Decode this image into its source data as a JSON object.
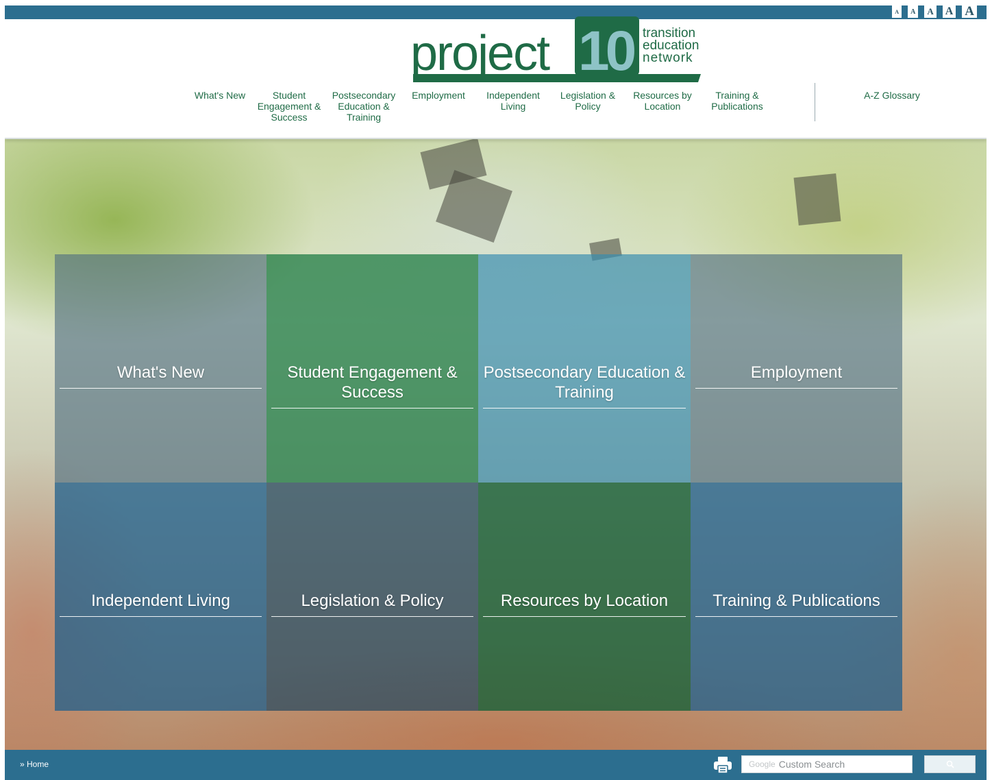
{
  "font_sizes": [
    "A",
    "A",
    "A",
    "A",
    "A"
  ],
  "logo": {
    "word": "project",
    "number": "10",
    "tagline": [
      "transition",
      "education",
      "network"
    ]
  },
  "nav": {
    "items": [
      {
        "label": "What's New"
      },
      {
        "label": "Student Engagement & Success"
      },
      {
        "label": "Postsecondary Education & Training"
      },
      {
        "label": "Employment"
      },
      {
        "label": "Independent Living"
      },
      {
        "label": "Legislation & Policy"
      },
      {
        "label": "Resources by Location"
      },
      {
        "label": "Training & Publications"
      }
    ],
    "glossary": "A-Z Glossary"
  },
  "tiles": [
    {
      "label": "What's New"
    },
    {
      "label": "Student Engagement & Success"
    },
    {
      "label": "Postsecondary Education & Training"
    },
    {
      "label": "Employment"
    },
    {
      "label": "Independent Living"
    },
    {
      "label": "Legislation & Policy"
    },
    {
      "label": "Resources by Location"
    },
    {
      "label": "Training & Publications"
    }
  ],
  "footer": {
    "breadcrumb": "» Home",
    "search_brand": "Google",
    "search_placeholder": "Custom Search",
    "search_icon": "search-icon",
    "print_icon": "printer-icon"
  },
  "colors": {
    "bar": "#2c6e8f",
    "nav_text": "#1f6b46",
    "logo_green": "#1f6b46",
    "logo_teal": "#8ec3c6"
  }
}
